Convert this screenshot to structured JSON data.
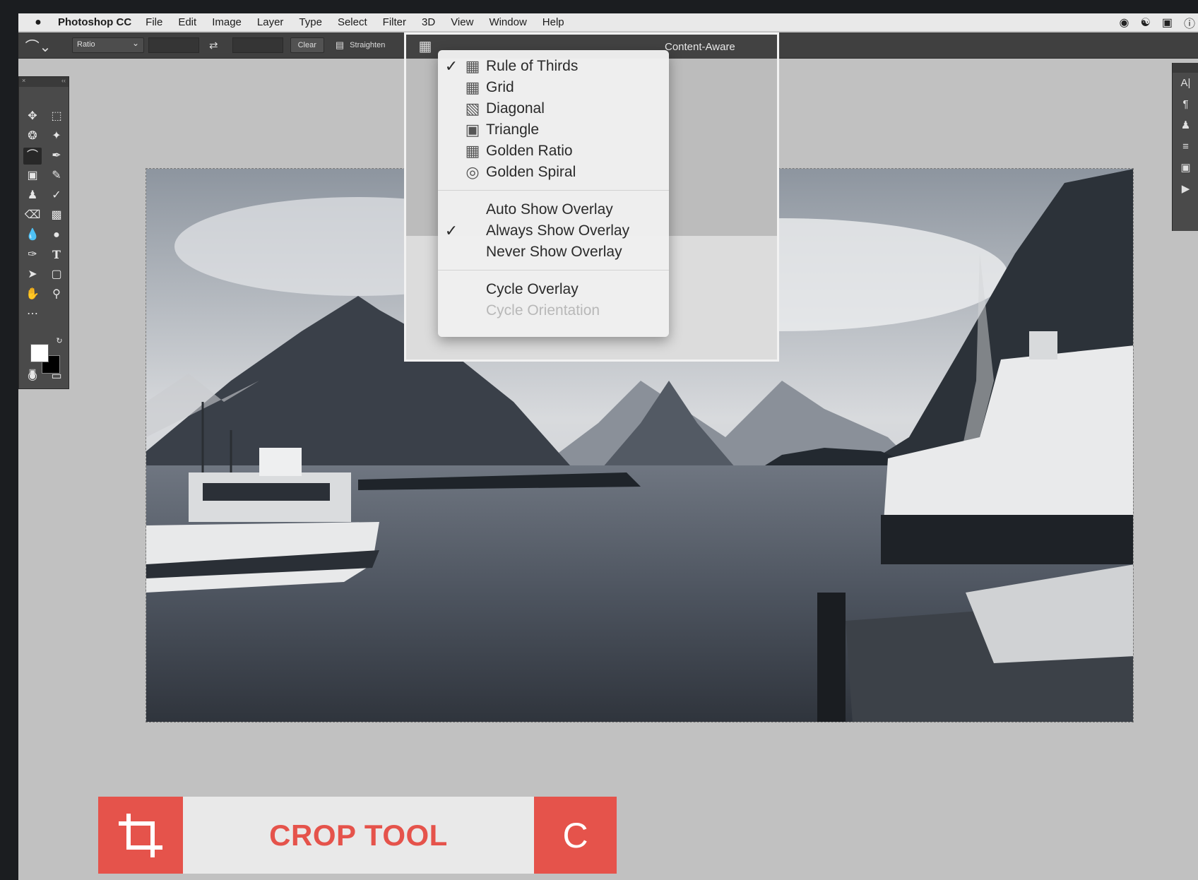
{
  "menubar": {
    "apple": "",
    "app_name": "Photoshop CC",
    "items": [
      "File",
      "Edit",
      "Image",
      "Layer",
      "Type",
      "Select",
      "Filter",
      "3D",
      "View",
      "Window",
      "Help"
    ]
  },
  "options_bar": {
    "ratio_label": "Ratio",
    "swap_icon": "⇄",
    "clear_label": "Clear",
    "straighten_label": "Straighten",
    "content_aware_label": "Content-Aware"
  },
  "overlay_menu": {
    "items": [
      {
        "label": "Rule of Thirds",
        "checked": true,
        "icon": "grid-icon"
      },
      {
        "label": "Grid",
        "checked": false,
        "icon": "grid-icon"
      },
      {
        "label": "Diagonal",
        "checked": false,
        "icon": "diagonal-icon"
      },
      {
        "label": "Triangle",
        "checked": false,
        "icon": "triangle-icon"
      },
      {
        "label": "Golden Ratio",
        "checked": false,
        "icon": "golden-ratio-icon"
      },
      {
        "label": "Golden Spiral",
        "checked": false,
        "icon": "golden-spiral-icon"
      }
    ],
    "show_options": [
      {
        "label": "Auto Show Overlay",
        "checked": false
      },
      {
        "label": "Always Show Overlay",
        "checked": true
      },
      {
        "label": "Never Show Overlay",
        "checked": false
      }
    ],
    "cycle_overlay": "Cycle Overlay",
    "cycle_orientation": "Cycle Orientation"
  },
  "banner": {
    "label": "CROP TOOL",
    "shortcut": "C",
    "accent": "#e5534b"
  }
}
